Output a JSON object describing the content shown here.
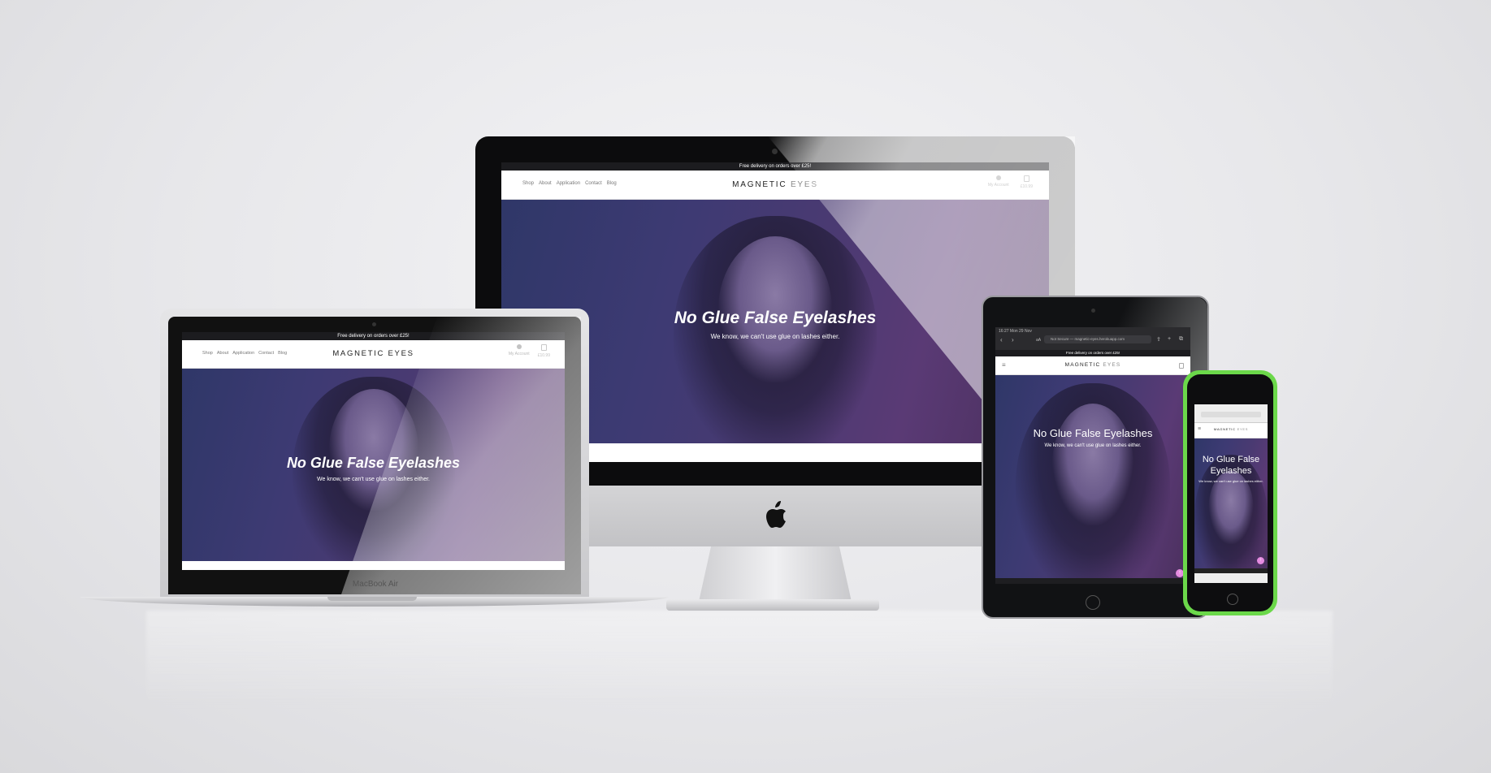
{
  "site": {
    "promo": "Free delivery on orders over £25!",
    "nav": [
      "Shop",
      "About",
      "Application",
      "Contact",
      "Blog"
    ],
    "logo_part1": "MAGNETIC",
    "logo_part2": "EYES",
    "account": "My Account",
    "cart": "£10.99",
    "hero_title": "No Glue False Eyelashes",
    "hero_subtitle": "We know, we can't use glue on lashes either."
  },
  "tablet_browser": {
    "time": "16:27  Mon 29 Nov",
    "aa": "aA",
    "url": "Not Secure — magnetic-eyes.herokuapp.com"
  },
  "phone_browser": {
    "hero_title_line1": "No Glue False",
    "hero_title_line2": "Eyelashes"
  },
  "device_label": "MacBook Air",
  "colors": {
    "promo_bar": "#1c1c1f",
    "hero_start": "#2f3768",
    "hero_end": "#4a2f5c",
    "phone_body": "#6bd84a",
    "scroll_button": "#e58be0"
  }
}
